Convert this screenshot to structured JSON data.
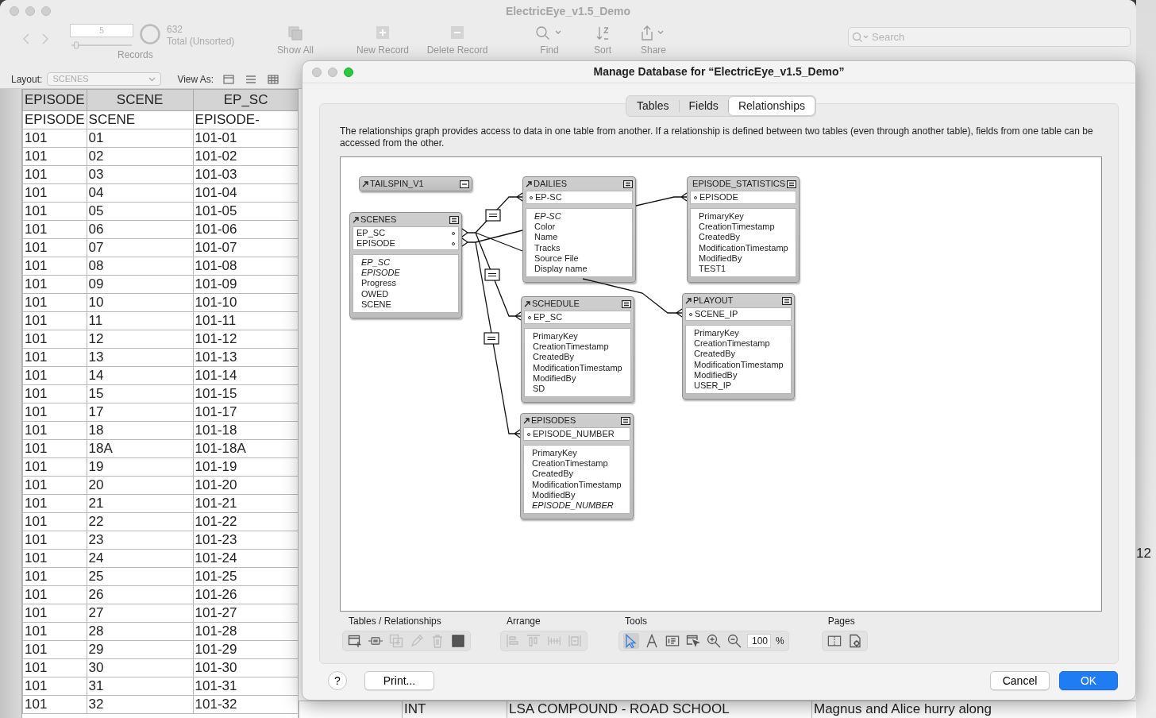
{
  "window": {
    "title": "ElectricEye_v1.5_Demo"
  },
  "toolbar": {
    "record_number": "5",
    "record_slider": {
      "level": 0.05
    },
    "found_count": "632",
    "found_status": "Total (Unsorted)",
    "records_label": "Records",
    "buttons": [
      {
        "kind": "show-all",
        "label": "Show All"
      },
      {
        "kind": "new-record",
        "label": "New Record"
      },
      {
        "kind": "delete-record",
        "label": "Delete Record"
      },
      {
        "kind": "find",
        "label": "Find"
      },
      {
        "kind": "sort",
        "label": "Sort"
      },
      {
        "kind": "share",
        "label": "Share"
      }
    ],
    "search": {
      "placeholder": "Search"
    }
  },
  "layout_bar": {
    "layout_label": "Layout:",
    "layout": "SCENES",
    "view_as_label": "View As:"
  },
  "table": {
    "columns": [
      "EPISODE",
      "SCENE",
      "EP_SC"
    ],
    "rows": [
      [
        "EPISODE",
        "SCENE",
        "EPISODE-"
      ],
      [
        "101",
        "01",
        "101-01"
      ],
      [
        "101",
        "02",
        "101-02"
      ],
      [
        "101",
        "03",
        "101-03"
      ],
      [
        "101",
        "04",
        "101-04"
      ],
      [
        "101",
        "05",
        "101-05"
      ],
      [
        "101",
        "06",
        "101-06"
      ],
      [
        "101",
        "07",
        "101-07"
      ],
      [
        "101",
        "08",
        "101-08"
      ],
      [
        "101",
        "09",
        "101-09"
      ],
      [
        "101",
        "10",
        "101-10"
      ],
      [
        "101",
        "11",
        "101-11"
      ],
      [
        "101",
        "12",
        "101-12"
      ],
      [
        "101",
        "13",
        "101-13"
      ],
      [
        "101",
        "14",
        "101-14"
      ],
      [
        "101",
        "15",
        "101-15"
      ],
      [
        "101",
        "17",
        "101-17"
      ],
      [
        "101",
        "18",
        "101-18"
      ],
      [
        "101",
        "18A",
        "101-18A"
      ],
      [
        "101",
        "19",
        "101-19"
      ],
      [
        "101",
        "20",
        "101-20"
      ],
      [
        "101",
        "21",
        "101-21"
      ],
      [
        "101",
        "22",
        "101-22"
      ],
      [
        "101",
        "23",
        "101-23"
      ],
      [
        "101",
        "24",
        "101-24"
      ],
      [
        "101",
        "25",
        "101-25"
      ],
      [
        "101",
        "26",
        "101-26"
      ],
      [
        "101",
        "27",
        "101-27"
      ],
      [
        "101",
        "28",
        "101-28"
      ],
      [
        "101",
        "29",
        "101-29"
      ],
      [
        "101",
        "30",
        "101-30"
      ],
      [
        "101",
        "31",
        "101-31"
      ],
      [
        "101",
        "32",
        "101-32"
      ]
    ]
  },
  "hidden_row": [
    "INT",
    "LSA COMPOUND - ROAD SCHOOL",
    "Magnus and Alice hurry along"
  ],
  "side_window": {
    "text": "12"
  },
  "dialog": {
    "title": "Manage Database for “ElectricEye_v1.5_Demo”",
    "tabs": [
      {
        "label": "Tables",
        "selected": false
      },
      {
        "label": "Fields",
        "selected": false
      },
      {
        "label": "Relationships",
        "selected": true
      }
    ],
    "description": "The relationships graph provides access to data in one table from another. If a relationship is defined between two tables (even through another table), fields from one table can be accessed from the other.",
    "graph": {
      "tables": [
        {
          "name": "TAILSPIN_V1",
          "collapsed": true
        },
        {
          "name": "SCENES",
          "collapsed": false,
          "key_fields": [
            "EP_SC",
            "EPISODE"
          ],
          "fields": [
            {
              "name": "EP_SC",
              "italic": true
            },
            {
              "name": "EPISODE",
              "italic": true
            },
            {
              "name": "Progress",
              "italic": false
            },
            {
              "name": "OWED",
              "italic": false
            },
            {
              "name": "SCENE",
              "italic": false
            }
          ]
        },
        {
          "name": "DAILIES",
          "collapsed": false,
          "key_fields": [
            "EP-SC"
          ],
          "fields": [
            {
              "name": "EP-SC",
              "italic": true
            },
            {
              "name": "Color",
              "italic": false
            },
            {
              "name": "Name",
              "italic": false
            },
            {
              "name": "Tracks",
              "italic": false
            },
            {
              "name": "Source File",
              "italic": false
            },
            {
              "name": "Display name",
              "italic": false
            }
          ]
        },
        {
          "name": "EPISODE_STATISTICS",
          "collapsed": false,
          "key_fields": [
            "EPISODE"
          ],
          "fields": [
            {
              "name": "PrimaryKey",
              "italic": false
            },
            {
              "name": "CreationTimestamp",
              "italic": false
            },
            {
              "name": "CreatedBy",
              "italic": false
            },
            {
              "name": "ModificationTimestamp",
              "italic": false
            },
            {
              "name": "ModifiedBy",
              "italic": false
            },
            {
              "name": "TEST1",
              "italic": false
            }
          ]
        },
        {
          "name": "SCHEDULE",
          "collapsed": false,
          "key_fields": [
            "EP_SC"
          ],
          "fields": [
            {
              "name": "PrimaryKey",
              "italic": false
            },
            {
              "name": "CreationTimestamp",
              "italic": false
            },
            {
              "name": "CreatedBy",
              "italic": false
            },
            {
              "name": "ModificationTimestamp",
              "italic": false
            },
            {
              "name": "ModifiedBy",
              "italic": false
            },
            {
              "name": "SD",
              "italic": false
            }
          ]
        },
        {
          "name": "PLAYOUT",
          "collapsed": false,
          "key_fields": [
            "SCENE_IP"
          ],
          "fields": [
            {
              "name": "PrimaryKey",
              "italic": false
            },
            {
              "name": "CreationTimestamp",
              "italic": false
            },
            {
              "name": "CreatedBy",
              "italic": false
            },
            {
              "name": "ModificationTimestamp",
              "italic": false
            },
            {
              "name": "ModifiedBy",
              "italic": false
            },
            {
              "name": "USER_IP",
              "italic": false
            }
          ]
        },
        {
          "name": "EPISODES",
          "collapsed": false,
          "key_fields": [
            "EPISODE_NUMBER"
          ],
          "fields": [
            {
              "name": "PrimaryKey",
              "italic": false
            },
            {
              "name": "CreationTimestamp",
              "italic": false
            },
            {
              "name": "CreatedBy",
              "italic": false
            },
            {
              "name": "ModificationTimestamp",
              "italic": false
            },
            {
              "name": "ModifiedBy",
              "italic": false
            },
            {
              "name": "EPISODE_NUMBER",
              "italic": true
            }
          ]
        }
      ]
    },
    "toolbar_sections": [
      {
        "label": "Tables / Relationships",
        "tools": [
          {
            "kind": "add-table",
            "disabled": false
          },
          {
            "kind": "add-relationship",
            "disabled": false
          },
          {
            "kind": "duplicate",
            "disabled": true
          },
          {
            "kind": "edit",
            "disabled": true
          },
          {
            "kind": "delete",
            "disabled": true
          },
          {
            "kind": "color",
            "disabled": false
          }
        ]
      },
      {
        "label": "Arrange",
        "tools": [
          {
            "kind": "align-left",
            "disabled": true
          },
          {
            "kind": "align-top",
            "disabled": true
          },
          {
            "kind": "distribute",
            "disabled": true
          },
          {
            "kind": "resize",
            "disabled": true
          }
        ]
      },
      {
        "label": "Tools",
        "tools": [
          {
            "kind": "pointer",
            "selected": true
          },
          {
            "kind": "text",
            "selected": false
          },
          {
            "kind": "note",
            "selected": false
          },
          {
            "kind": "select-related",
            "selected": false
          },
          {
            "kind": "zoom-in",
            "selected": false
          },
          {
            "kind": "zoom-out",
            "selected": false
          }
        ],
        "zoom_value": "100",
        "zoom_unit": "%"
      },
      {
        "label": "Pages",
        "tools": [
          {
            "kind": "page-breaks",
            "disabled": false
          },
          {
            "kind": "page-setup",
            "disabled": false
          }
        ]
      }
    ],
    "help_button": "?",
    "print_button": "Print...",
    "cancel_button": "Cancel",
    "ok_button": "OK"
  }
}
